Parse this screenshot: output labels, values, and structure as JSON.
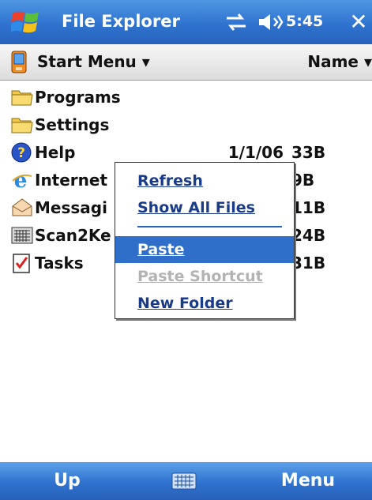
{
  "titlebar": {
    "title": "File Explorer",
    "time": "5:45",
    "close_label": "✕",
    "icons": [
      "windows-logo-icon",
      "connectivity-icon",
      "volume-icon"
    ]
  },
  "navbar": {
    "folder_label": "Start Menu ▾",
    "sort_label": "Name ▾"
  },
  "files": [
    {
      "name": "Programs",
      "date": "",
      "size": "",
      "icon": "folder-icon"
    },
    {
      "name": "Settings",
      "date": "",
      "size": "",
      "icon": "folder-icon"
    },
    {
      "name": "Help",
      "date": "1/1/06",
      "size": "33B",
      "icon": "help-icon"
    },
    {
      "name": "Internet",
      "date": "",
      "size": "9B",
      "icon": "internet-explorer-icon"
    },
    {
      "name": "Messagi",
      "date": "",
      "size": "11B",
      "icon": "messaging-icon"
    },
    {
      "name": "Scan2Ke",
      "date": "",
      "size": "24B",
      "icon": "keyboard-app-icon"
    },
    {
      "name": "Tasks",
      "date": "",
      "size": "31B",
      "icon": "tasks-icon"
    }
  ],
  "context_menu": {
    "items": [
      {
        "label": "Refresh",
        "state": "normal"
      },
      {
        "label": "Show All Files",
        "state": "normal"
      },
      {
        "label": "Paste",
        "state": "selected"
      },
      {
        "label": "Paste Shortcut",
        "state": "disabled"
      },
      {
        "label": "New Folder",
        "state": "normal"
      }
    ]
  },
  "bottombar": {
    "left_softkey": "Up",
    "right_softkey": "Menu",
    "center_icon": "keyboard-icon"
  },
  "colors": {
    "title_blue": "#2f73cf",
    "menu_highlight": "#2f6fc9",
    "menu_text": "#1a3b8a",
    "disabled_text": "#b3b3b3"
  }
}
